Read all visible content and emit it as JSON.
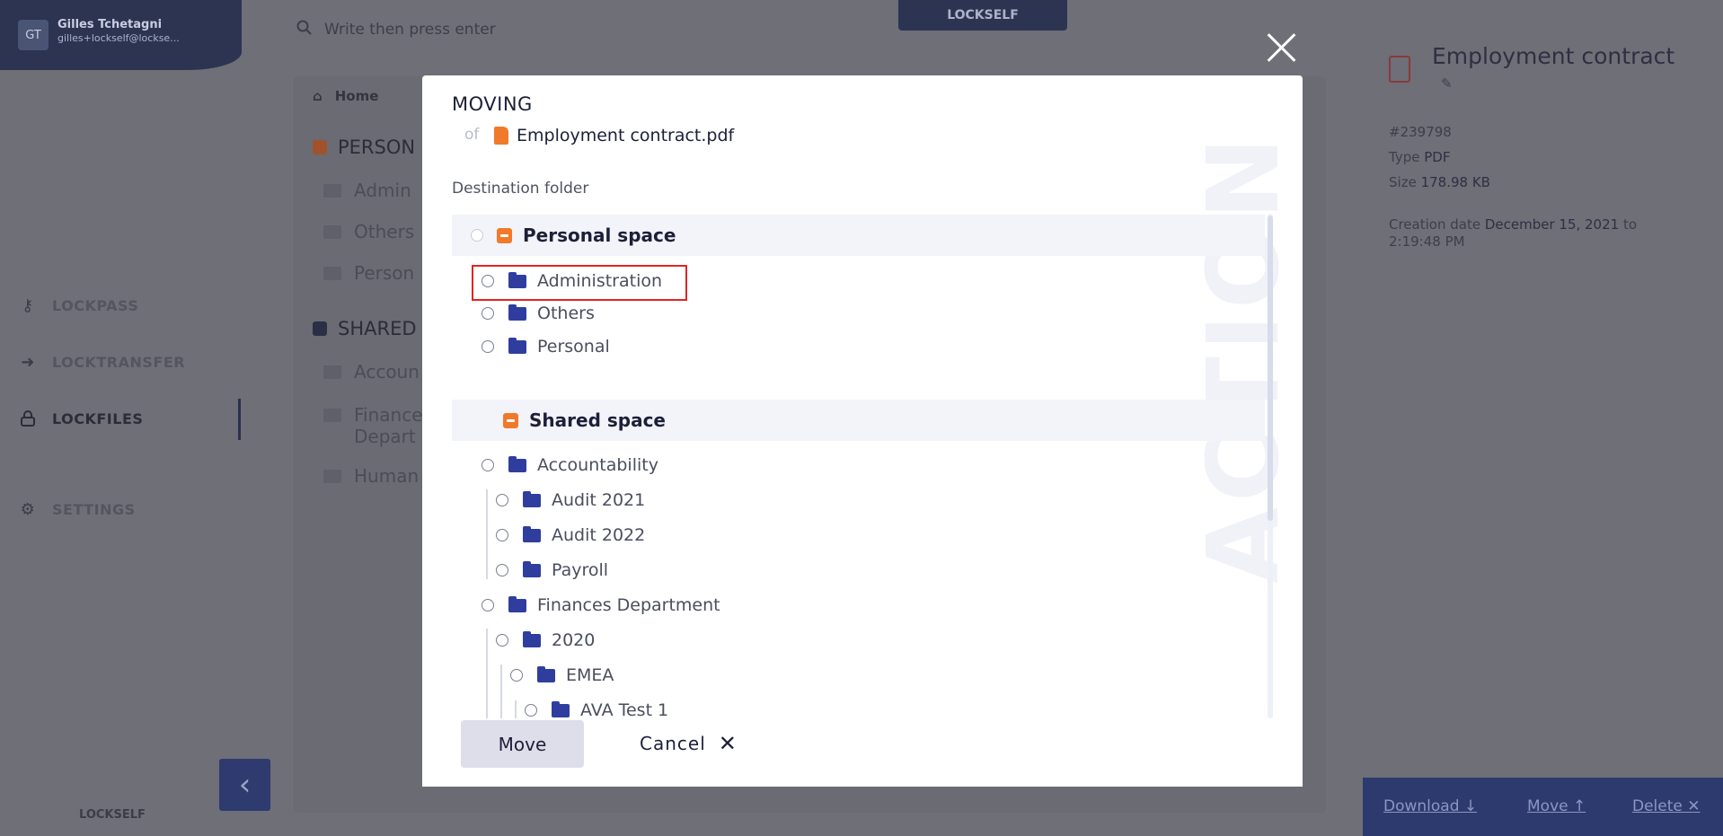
{
  "user": {
    "initials": "GT",
    "name": "Gilles Tchetagni",
    "email": "gilles+lockself@lockse..."
  },
  "nav": [
    {
      "label": "LOCKPASS",
      "icon": "key-icon"
    },
    {
      "label": "LOCKTRANSFER",
      "icon": "arrow-right-icon"
    },
    {
      "label": "LOCKFILES",
      "icon": "lock-icon"
    },
    {
      "label": "SETTINGS",
      "icon": "gear-icon"
    }
  ],
  "brand": {
    "prefix": "LOCK",
    "suffix": "SELF"
  },
  "search": {
    "placeholder": "Write then press enter"
  },
  "background": {
    "home": "Home",
    "personal_section": "PERSON",
    "personal_folders": [
      "Admin",
      "Others",
      "Person"
    ],
    "shared_section": "SHARED",
    "shared_folders": [
      "Accoun",
      "Finance",
      "Depart",
      "Human"
    ]
  },
  "details": {
    "title": "Employment contract",
    "id": "#239798",
    "type_label": "Type",
    "type_value": "PDF",
    "size_label": "Size",
    "size_value": "178.98 KB",
    "created_label": "Creation date",
    "created_date": "December 15, 2021",
    "created_at": "to",
    "created_time": "2:19:48 PM",
    "actions": {
      "download": "Download",
      "move": "Move",
      "delete": "Delete"
    }
  },
  "modal": {
    "title": "MOVING",
    "of_label": "of",
    "file_name": "Employment contract.pdf",
    "destination_label": "Destination folder",
    "watermark": "ACTION",
    "personal_space": {
      "label": "Personal space",
      "folders": [
        "Administration",
        "Others",
        "Personal"
      ]
    },
    "shared_space": {
      "label": "Shared space",
      "folders": [
        "Accountability",
        "Audit 2021",
        "Audit 2022",
        "Payroll",
        "Finances Department",
        "2020",
        "EMEA",
        "AVA Test 1"
      ]
    },
    "buttons": {
      "move": "Move",
      "cancel": "Cancel"
    }
  }
}
